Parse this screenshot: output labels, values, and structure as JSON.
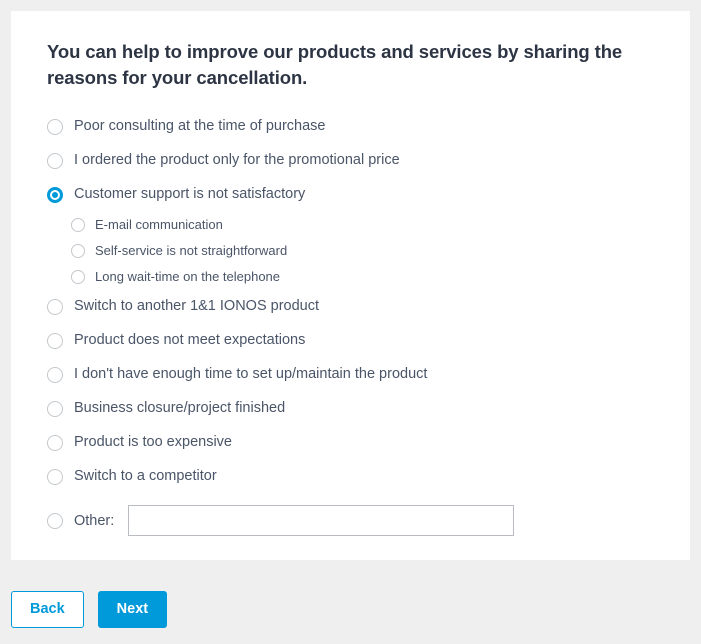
{
  "colors": {
    "page_background": "#efefef",
    "card_background": "#ffffff",
    "accent": "#0099da",
    "heading_text": "#2d3544",
    "option_text": "#4a5568",
    "radio_border": "#c4c8cc",
    "input_border": "#b9bdc1"
  },
  "card": {
    "heading": "You can help to improve our products and services by sharing the reasons for your cancellation."
  },
  "options": [
    {
      "label": "Poor consulting at the time of purchase",
      "selected": false,
      "level": 0
    },
    {
      "label": "I ordered the product only for the promotional price",
      "selected": false,
      "level": 0
    },
    {
      "label": "Customer support is not satisfactory",
      "selected": true,
      "level": 0
    },
    {
      "label": "E-mail communication",
      "selected": false,
      "level": 1
    },
    {
      "label": "Self-service is not straightforward",
      "selected": false,
      "level": 1
    },
    {
      "label": "Long wait-time on the telephone",
      "selected": false,
      "level": 1
    },
    {
      "label": "Switch to another 1&1 IONOS product",
      "selected": false,
      "level": 0
    },
    {
      "label": "Product does not meet expectations",
      "selected": false,
      "level": 0
    },
    {
      "label": "I don't have enough time to set up/maintain the product",
      "selected": false,
      "level": 0
    },
    {
      "label": "Business closure/project finished",
      "selected": false,
      "level": 0
    },
    {
      "label": "Product is too expensive",
      "selected": false,
      "level": 0
    },
    {
      "label": "Switch to a competitor",
      "selected": false,
      "level": 0
    }
  ],
  "other": {
    "label": "Other:",
    "value": "",
    "placeholder": "",
    "selected": false
  },
  "footer": {
    "back_label": "Back",
    "next_label": "Next"
  }
}
